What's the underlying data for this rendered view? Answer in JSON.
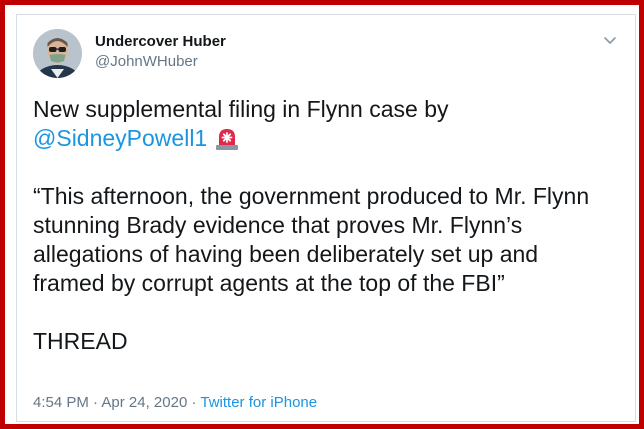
{
  "tweet": {
    "display_name": "Undercover Huber",
    "handle": "@JohnWHuber",
    "line1": "New supplemental filing in Flynn case by",
    "mention": "@SidneyPowell1",
    "quote_lines": [
      "“This afternoon, the government produced to Mr. Flynn",
      "stunning Brady evidence that proves Mr. Flynn’s",
      "allegations of having been deliberately set up and",
      "framed by corrupt agents at the top of the FBI”"
    ],
    "closing": "THREAD",
    "time": "4:54 PM",
    "separator": "·",
    "date": "Apr 24, 2020",
    "source": "Twitter for iPhone"
  },
  "icons": {
    "caret": "chevron-down-icon",
    "emoji": "police-siren-icon"
  },
  "colors": {
    "frame": "#c00000",
    "link": "#1b95e0",
    "muted": "#657786",
    "text": "#14171a"
  }
}
